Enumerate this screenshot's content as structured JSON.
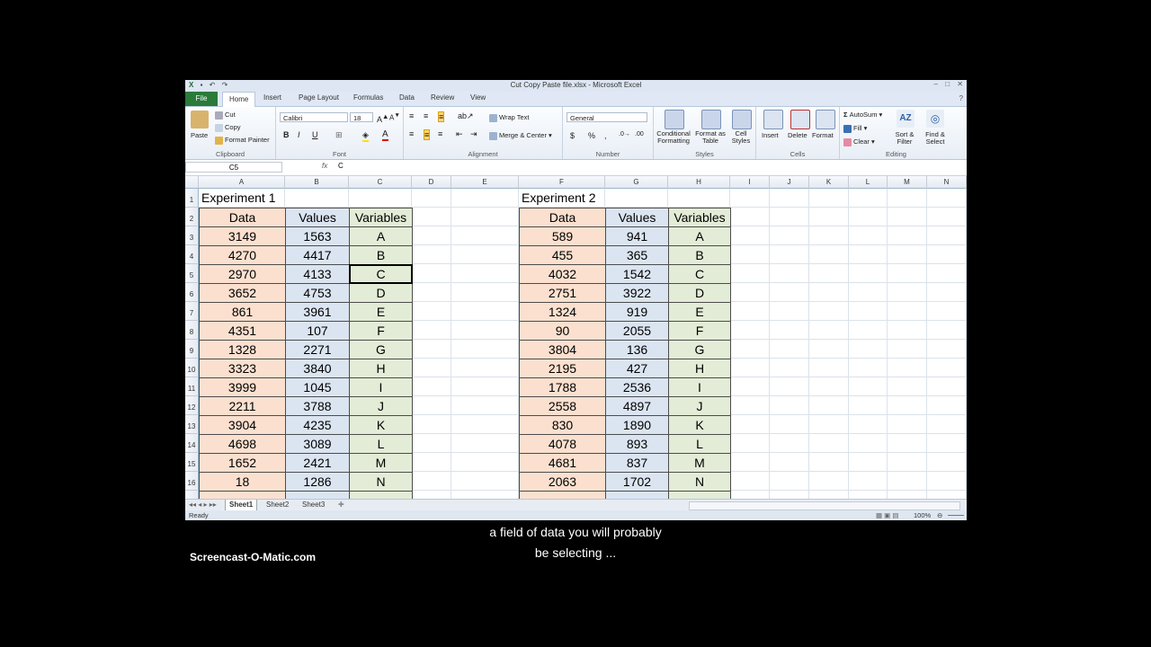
{
  "window": {
    "title": "Cut Copy Paste file.xlsx  -  Microsoft Excel",
    "controls": [
      "–",
      "□",
      "✕"
    ]
  },
  "tabs": [
    "File",
    "Home",
    "Insert",
    "Page Layout",
    "Formulas",
    "Data",
    "Review",
    "View"
  ],
  "ribbon": {
    "clipboard": {
      "paste": "Paste",
      "cut": "Cut",
      "copy": "Copy",
      "format_painter": "Format Painter",
      "label": "Clipboard"
    },
    "font": {
      "name": "Calibri",
      "size": "18",
      "bold": "B",
      "italic": "I",
      "underline": "U",
      "label": "Font"
    },
    "alignment": {
      "wrap": "Wrap Text",
      "merge": "Merge & Center",
      "label": "Alignment"
    },
    "number": {
      "format": "General",
      "currency": "$",
      "percent": "%",
      "comma": ",",
      "label": "Number"
    },
    "styles": {
      "conditional": "Conditional Formatting",
      "format_table": "Format as Table",
      "cell_styles": "Cell Styles",
      "label": "Styles"
    },
    "cells": {
      "insert": "Insert",
      "delete": "Delete",
      "format": "Format",
      "label": "Cells"
    },
    "editing": {
      "autosum": "AutoSum",
      "fill": "Fill",
      "clear": "Clear",
      "sort": "Sort & Filter",
      "find": "Find & Select",
      "label": "Editing"
    }
  },
  "formula_bar": {
    "name_box": "C5",
    "fx": "fx",
    "value": "C"
  },
  "columns": [
    "A",
    "B",
    "C",
    "D",
    "E",
    "F",
    "G",
    "H",
    "I",
    "J",
    "K",
    "L",
    "M",
    "N"
  ],
  "rows": [
    "1",
    "2",
    "3",
    "4",
    "5",
    "6",
    "7",
    "8",
    "9",
    "10",
    "11",
    "12",
    "13",
    "14",
    "15",
    "16"
  ],
  "experiment1": {
    "title": "Experiment 1",
    "headers": [
      "Data",
      "Values",
      "Variables"
    ],
    "rows": [
      [
        "3149",
        "1563",
        "A"
      ],
      [
        "4270",
        "4417",
        "B"
      ],
      [
        "2970",
        "4133",
        "C"
      ],
      [
        "3652",
        "4753",
        "D"
      ],
      [
        "861",
        "3961",
        "E"
      ],
      [
        "4351",
        "107",
        "F"
      ],
      [
        "1328",
        "2271",
        "G"
      ],
      [
        "3323",
        "3840",
        "H"
      ],
      [
        "3999",
        "1045",
        "I"
      ],
      [
        "2211",
        "3788",
        "J"
      ],
      [
        "3904",
        "4235",
        "K"
      ],
      [
        "4698",
        "3089",
        "L"
      ],
      [
        "1652",
        "2421",
        "M"
      ],
      [
        "18",
        "1286",
        "N"
      ]
    ]
  },
  "experiment2": {
    "title": "Experiment 2",
    "headers": [
      "Data",
      "Values",
      "Variables"
    ],
    "rows": [
      [
        "589",
        "941",
        "A"
      ],
      [
        "455",
        "365",
        "B"
      ],
      [
        "4032",
        "1542",
        "C"
      ],
      [
        "2751",
        "3922",
        "D"
      ],
      [
        "1324",
        "919",
        "E"
      ],
      [
        "90",
        "2055",
        "F"
      ],
      [
        "3804",
        "136",
        "G"
      ],
      [
        "2195",
        "427",
        "H"
      ],
      [
        "1788",
        "2536",
        "I"
      ],
      [
        "2558",
        "4897",
        "J"
      ],
      [
        "830",
        "1890",
        "K"
      ],
      [
        "4078",
        "893",
        "L"
      ],
      [
        "4681",
        "837",
        "M"
      ],
      [
        "2063",
        "1702",
        "N"
      ]
    ]
  },
  "sheets": [
    "Sheet1",
    "Sheet2",
    "Sheet3"
  ],
  "status": {
    "ready": "Ready",
    "zoom": "100%"
  },
  "caption": {
    "line1": "a field of data you will probably",
    "line2": "be selecting ..."
  },
  "watermark": "Screencast-O-Matic.com",
  "colors": {
    "data_fill": "#fbe0cf",
    "values_fill": "#dbe5f1",
    "variables_fill": "#e3ecd6",
    "file_tab": "#2a7a3a"
  }
}
